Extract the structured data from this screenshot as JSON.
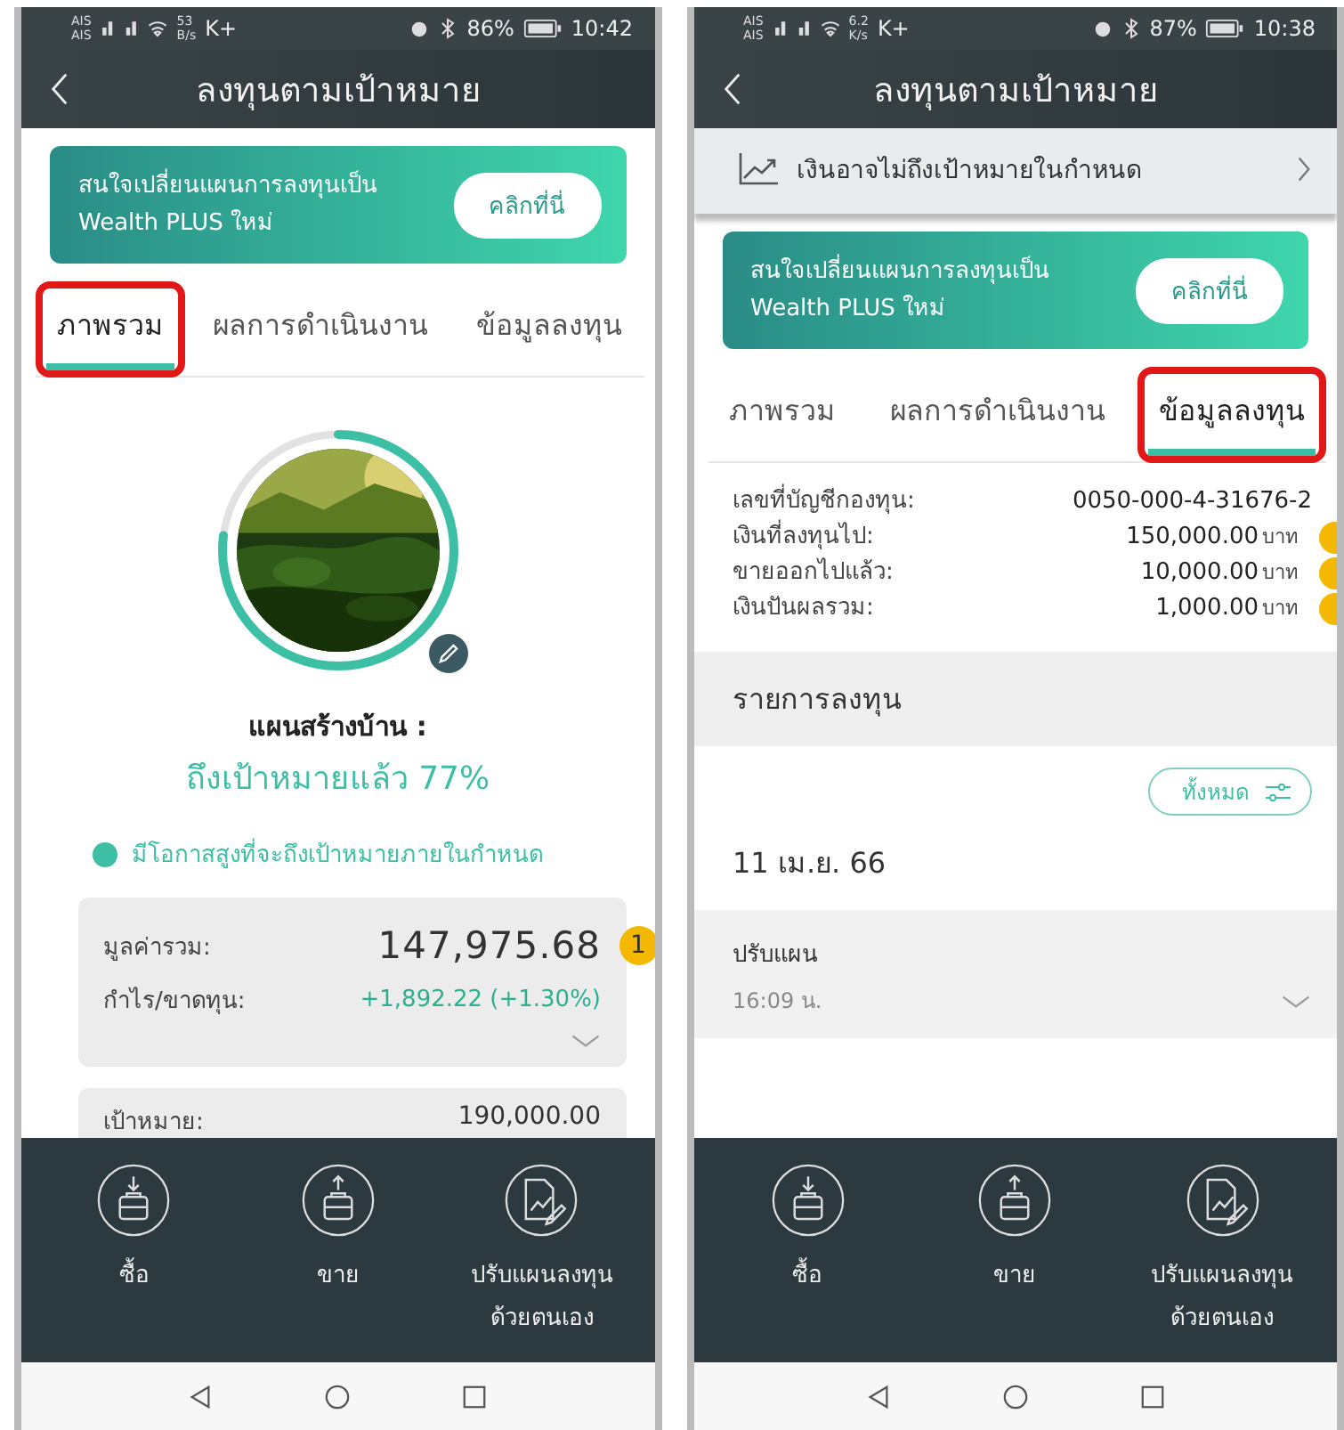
{
  "screens": [
    {
      "status_bar": {
        "carriers": [
          "AIS",
          "AIS"
        ],
        "speed": "53",
        "speed_unit": "B/s",
        "extra": "K+",
        "battery": "86%",
        "time": "10:42"
      },
      "header": {
        "title": "ลงทุนตามเป้าหมาย"
      },
      "banner": {
        "lines": [
          "สนใจเปลี่ยนแผนการลงทุนเป็น",
          "Wealth PLUS ใหม่"
        ],
        "button": "คลิกที่นี่"
      },
      "tabs": [
        {
          "label": "ภาพรวม",
          "selected": true,
          "highlighted": true
        },
        {
          "label": "ผลการดำเนินงาน",
          "selected": false,
          "highlighted": false
        },
        {
          "label": "ข้อมูลลงทุน",
          "selected": false,
          "highlighted": false
        }
      ],
      "content": {
        "kind": "overview",
        "level": 0.77,
        "plan_label": "แผนสร้างบ้าน :",
        "progress_text": "ถึงเป้าหมายแล้ว 77%",
        "status": {
          "text": "มีโอกาสสูงที่จะถึงเป้าหมายภายในกำหนด",
          "color": "#3dbfa6"
        },
        "summary": [
          {
            "label": "มูลค่ารวม:",
            "value": "147,975.68",
            "kind": "total",
            "marker": "1"
          },
          {
            "label": "กำไร/ขาดทุน:",
            "value": "+1,892.22 (+1.30%)",
            "kind": "gain"
          }
        ],
        "target": {
          "label": "เป้าหมาย:",
          "value": "190,000.00"
        }
      },
      "actions": [
        {
          "kind": "buy",
          "label": "ซื้อ"
        },
        {
          "kind": "sell",
          "label": "ขาย"
        },
        {
          "kind": "adjust",
          "label": "ปรับแผนลงทุน\nด้วยตนเอง"
        }
      ]
    },
    {
      "status_bar": {
        "carriers": [
          "AIS",
          "AIS"
        ],
        "speed": "6.2",
        "speed_unit": "K/s",
        "extra": "K+",
        "battery": "87%",
        "time": "10:38"
      },
      "header": {
        "title": "ลงทุนตามเป้าหมาย"
      },
      "alert": {
        "text": "เงินอาจไม่ถึงเป้าหมายในกำหนด"
      },
      "banner": {
        "lines": [
          "สนใจเปลี่ยนแผนการลงทุนเป็น",
          "Wealth PLUS ใหม่"
        ],
        "button": "คลิกที่นี่"
      },
      "tabs": [
        {
          "label": "ภาพรวม",
          "selected": false,
          "highlighted": false
        },
        {
          "label": "ผลการดำเนินงาน",
          "selected": false,
          "highlighted": false
        },
        {
          "label": "ข้อมูลลงทุน",
          "selected": true,
          "highlighted": true
        }
      ],
      "content": {
        "kind": "info",
        "rows": [
          {
            "label": "เลขที่บัญชีกองทุน:",
            "value": "0050-000-4-31676-2",
            "marked": false
          },
          {
            "label": "เงินที่ลงทุนไป:",
            "value": "150,000.00",
            "unit": "บาท",
            "marked": true
          },
          {
            "label": "ขายออกไปแล้ว:",
            "value": "10,000.00",
            "unit": "บาท",
            "marked": true
          },
          {
            "label": "เงินปันผลรวม:",
            "value": "1,000.00",
            "unit": "บาท",
            "marked": true
          }
        ],
        "section": "รายการลงทุน",
        "filter": "ทั้งหมด",
        "date": "11 เม.ย. 66",
        "transaction": {
          "title": "ปรับแผน",
          "time": "16:09 น."
        }
      },
      "actions": [
        {
          "kind": "buy",
          "label": "ซื้อ"
        },
        {
          "kind": "sell",
          "label": "ขาย"
        },
        {
          "kind": "adjust",
          "label": "ปรับแผนลงทุน\nด้วยตนเอง"
        }
      ]
    }
  ]
}
